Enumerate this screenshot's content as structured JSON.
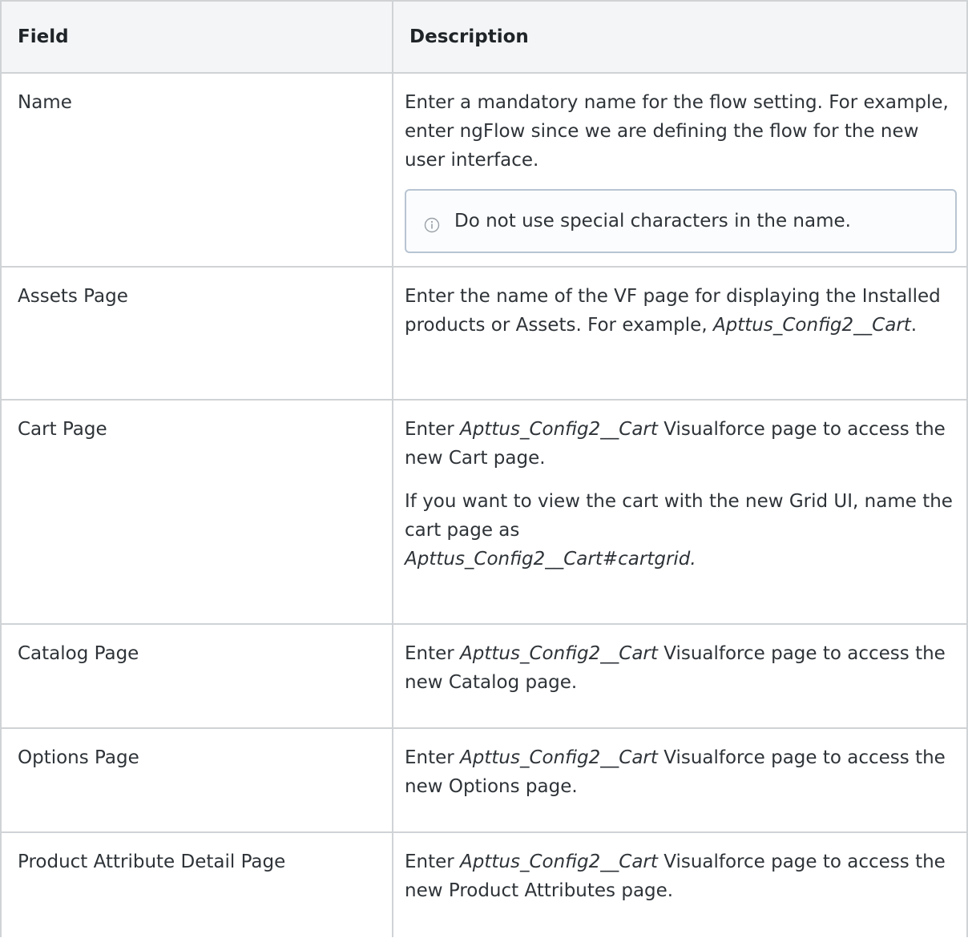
{
  "table": {
    "headers": {
      "field": "Field",
      "description": "Description"
    },
    "rows": [
      {
        "field": "Name",
        "desc_text": "Enter a mandatory name for the flow setting. For example, enter ngFlow since we are defining the flow for the new user interface.",
        "note": "Do not use special characters in the name."
      },
      {
        "field": "Assets Page",
        "desc_before": "Enter the name of the VF page for displaying the Installed products or Assets. For example, ",
        "desc_em": "Apttus_Config2__Cart",
        "desc_after": "."
      },
      {
        "field": "Cart Page",
        "desc_em": "Apttus_Config2__Cart",
        "desc_after": " Visualforce page to access the new Cart page.",
        "desc_before": "Enter ",
        "desc2_before": "If you want to view the cart with the new Grid UI, name the cart page as ",
        "desc2_em": "Apttus_Config2__Cart#cartgrid."
      },
      {
        "field": "Catalog Page",
        "desc_before": "Enter ",
        "desc_em": "Apttus_Config2__Cart",
        "desc_after": " Visualforce page to access the new Catalog page."
      },
      {
        "field": "Options Page",
        "desc_before": "Enter ",
        "desc_em": "Apttus_Config2__Cart",
        "desc_after": " Visualforce page to access the new Options page."
      },
      {
        "field": "Product Attribute Detail Page",
        "desc_before": "Enter ",
        "desc_em": "Apttus_Config2__Cart",
        "desc_after": " Visualforce page to access the new Product Attributes page."
      }
    ]
  },
  "icons": {
    "note_icon": "info-circle-icon"
  },
  "colors": {
    "border": "#d0d3d6",
    "header_bg": "#f4f5f6",
    "note_border": "#b8c4d2"
  }
}
